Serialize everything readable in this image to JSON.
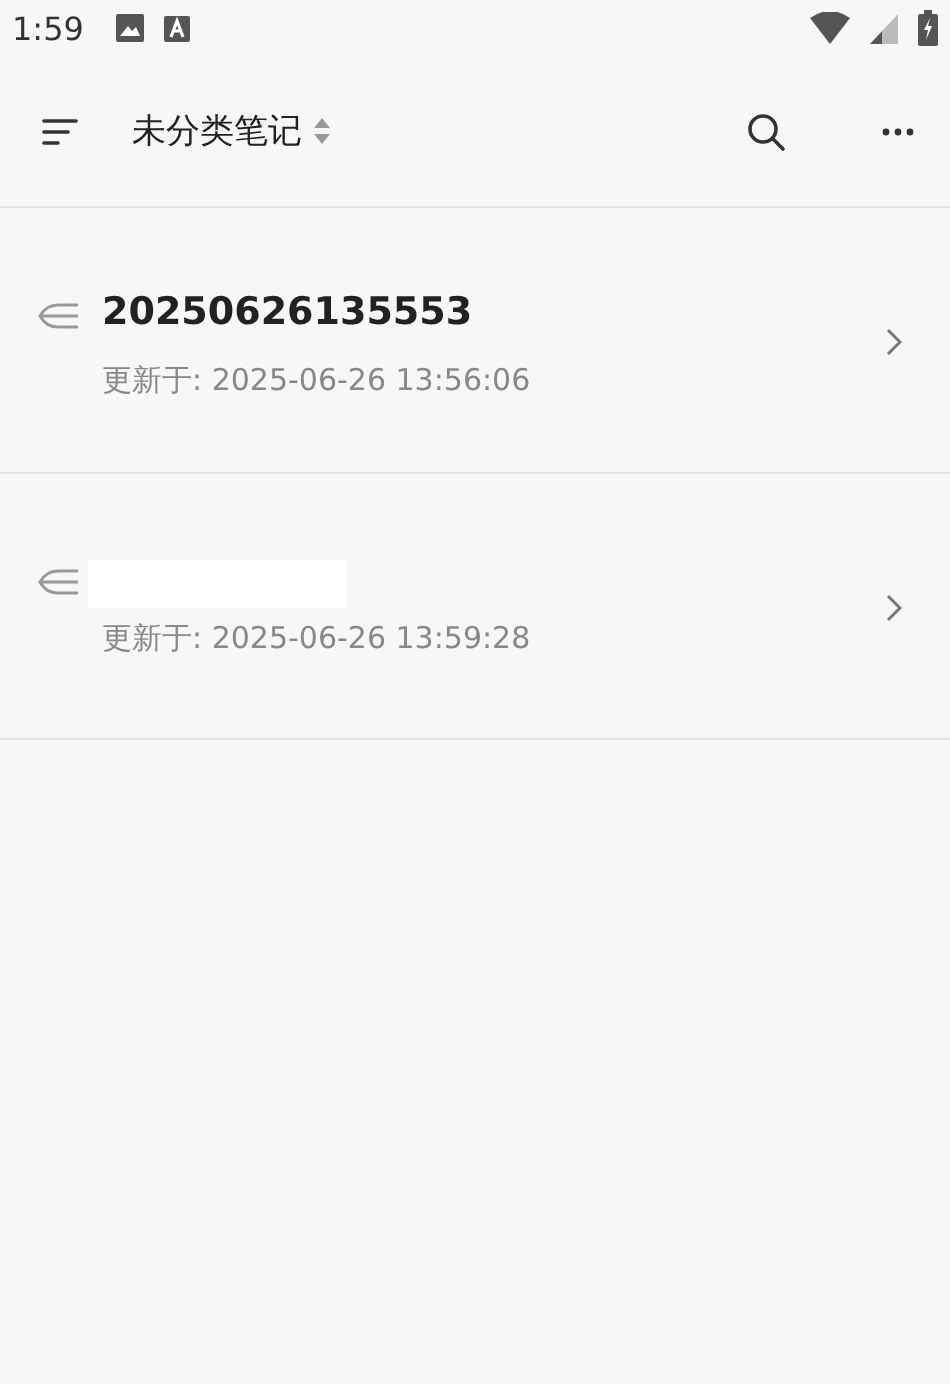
{
  "status_bar": {
    "time": "1:59"
  },
  "toolbar": {
    "title": "未分类笔记"
  },
  "notes": [
    {
      "kind": "titled",
      "title": "20250626135553",
      "updated": "更新于: 2025-06-26 13:56:06"
    },
    {
      "kind": "blank",
      "updated": "更新于: 2025-06-26 13:59:28"
    }
  ]
}
